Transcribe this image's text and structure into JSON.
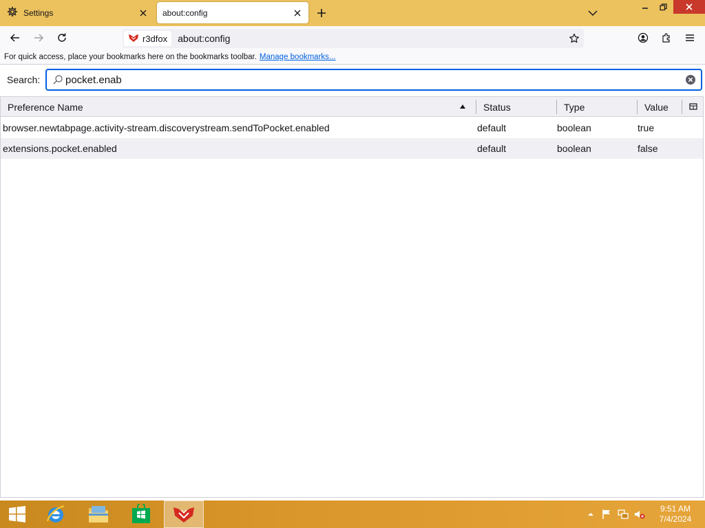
{
  "browser": {
    "tabs": [
      {
        "label": "Settings",
        "icon": "gear-icon",
        "active": false
      },
      {
        "label": "about:config",
        "active": true
      }
    ],
    "identity_label": "r3dfox",
    "url": "about:config"
  },
  "bookmarks_bar": {
    "message": "For quick access, place your bookmarks here on the bookmarks toolbar.",
    "link": "Manage bookmarks..."
  },
  "search": {
    "label": "Search:",
    "value": "pocket.enab"
  },
  "table": {
    "columns": [
      "Preference Name",
      "Status",
      "Type",
      "Value"
    ],
    "sort_column": "Preference Name",
    "rows": [
      {
        "name": "browser.newtabpage.activity-stream.discoverystream.sendToPocket.enabled",
        "status": "default",
        "type": "boolean",
        "value": "true"
      },
      {
        "name": "extensions.pocket.enabled",
        "status": "default",
        "type": "boolean",
        "value": "false"
      }
    ]
  },
  "taskbar": {
    "apps": [
      "start-button",
      "internet-explorer-icon",
      "file-explorer-icon",
      "store-icon",
      "r3dfox-icon"
    ],
    "clock_time": "9:51 AM",
    "clock_date": "7/4/2024"
  },
  "colors": {
    "tabbar": "#ecc25e",
    "accent": "#0061e0",
    "taskbar": "#d9962a",
    "close_button": "#c8392b"
  }
}
